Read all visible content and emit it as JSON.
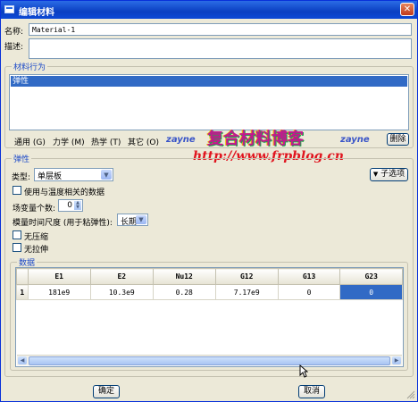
{
  "window": {
    "title": "编辑材料",
    "close": "✕"
  },
  "form": {
    "name_label": "名称:",
    "name_value": "Material-1",
    "desc_label": "描述:",
    "desc_value": ""
  },
  "behavior": {
    "group_label": "材料行为",
    "items": [
      "弹性"
    ],
    "menus": [
      {
        "label": "通用 (G)"
      },
      {
        "label": "力学 (M)"
      },
      {
        "label": "热学 (T)"
      },
      {
        "label": "其它 (O)"
      }
    ],
    "delete_label": "删除"
  },
  "watermark": {
    "left": "zayne",
    "center": "复合材料博客",
    "right": "zayne",
    "url": "http://www.frpblog.cn"
  },
  "elastic": {
    "group_label": "弹性",
    "type_label": "类型:",
    "type_value": "单层板",
    "suboptions_label": "子选项",
    "temp_dep_label": "使用与温度相关的数据",
    "field_vars_label": "场变量个数:",
    "field_vars_value": "0",
    "timescale_label": "模量时间尺度 (用于粘弹性):",
    "timescale_value": "长期",
    "no_compression_label": "无压缩",
    "no_tension_label": "无拉伸"
  },
  "data": {
    "group_label": "数据",
    "columns": [
      "E1",
      "E2",
      "Nu12",
      "G12",
      "G13",
      "G23"
    ],
    "rows": [
      {
        "index": "1",
        "cells": [
          "181e9",
          "10.3e9",
          "0.28",
          "7.17e9",
          "0",
          "0"
        ]
      }
    ]
  },
  "footer": {
    "ok_label": "确定",
    "cancel_label": "取消"
  }
}
